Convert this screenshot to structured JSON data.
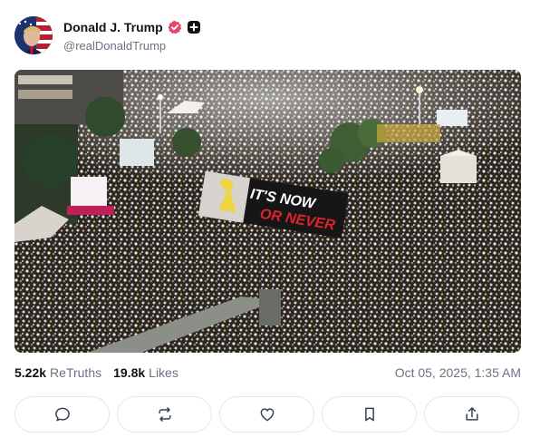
{
  "author": {
    "display_name": "Donald J. Trump",
    "handle": "@realDonaldTrump",
    "verified_icon": "verified-badge-icon",
    "plus_icon": "plus-badge-icon"
  },
  "media": {
    "banner_line1": "IT'S NOW",
    "banner_line2": "OR NEVER"
  },
  "stats": {
    "retruths_count": "5.22k",
    "retruths_label": "ReTruths",
    "likes_count": "19.8k",
    "likes_label": "Likes",
    "timestamp": "Oct 05, 2025, 1:35 AM"
  },
  "actions": {
    "reply_icon": "comment-icon",
    "retruth_icon": "repost-icon",
    "like_icon": "heart-icon",
    "bookmark_icon": "bookmark-icon",
    "share_icon": "share-icon"
  },
  "colors": {
    "verified": "#e5476b",
    "text_primary": "#0f1419",
    "text_secondary": "#6b7280",
    "border": "#e5e7eb"
  }
}
